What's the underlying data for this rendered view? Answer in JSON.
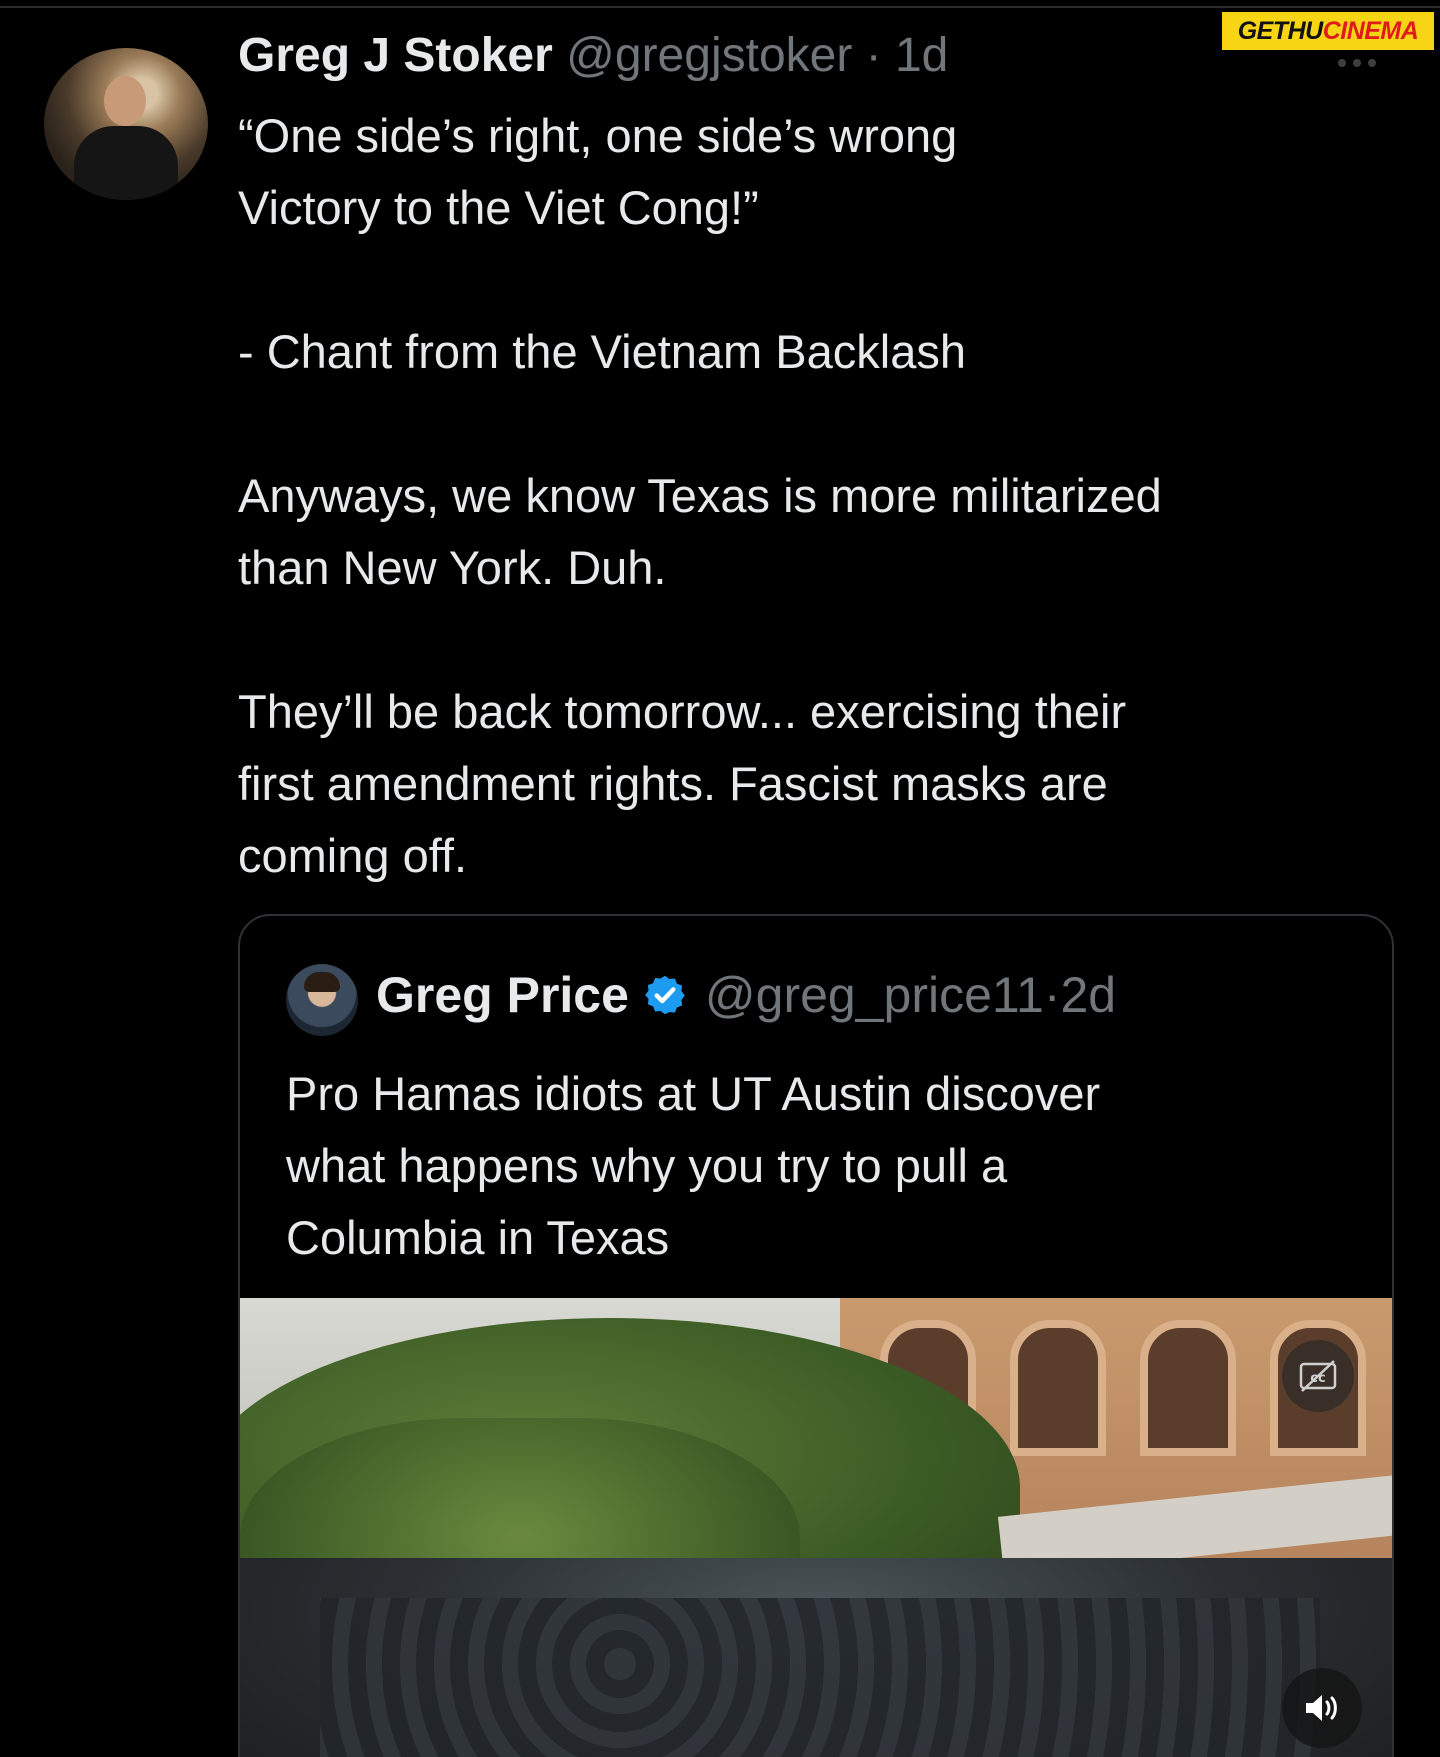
{
  "watermark": {
    "part1": "GETHU",
    "part2": "CINEMA"
  },
  "tweet": {
    "author_name": "Greg J Stoker",
    "handle": "@gregjstoker",
    "separator": " · ",
    "time": "1d",
    "lines": [
      "“One side’s right, one side’s wrong",
      "Victory to the Viet Cong!”",
      "",
      "- Chant from the Vietnam Backlash",
      "",
      "Anyways, we know Texas is more militarized",
      "than New York. Duh.",
      "",
      "They’ll be back tomorrow... exercising their",
      "first amendment rights. Fascist masks are",
      "coming off."
    ]
  },
  "quoted": {
    "author_name": "Greg Price",
    "handle": "@greg_price11",
    "separator": " · ",
    "time": "2d",
    "lines": [
      "Pro Hamas idiots at UT Austin discover",
      "what happens why you try to pull a",
      "Columbia in Texas"
    ]
  },
  "icons": {
    "more": "more-options-icon",
    "verified": "verified-badge-icon",
    "captions": "captions-off-icon",
    "sound": "speaker-icon"
  },
  "colors": {
    "background": "#000000",
    "text": "#e7e9ea",
    "muted": "#71767b",
    "verified": "#1d9bf0",
    "border": "#2f3336",
    "watermark_bg": "#f7d515"
  }
}
